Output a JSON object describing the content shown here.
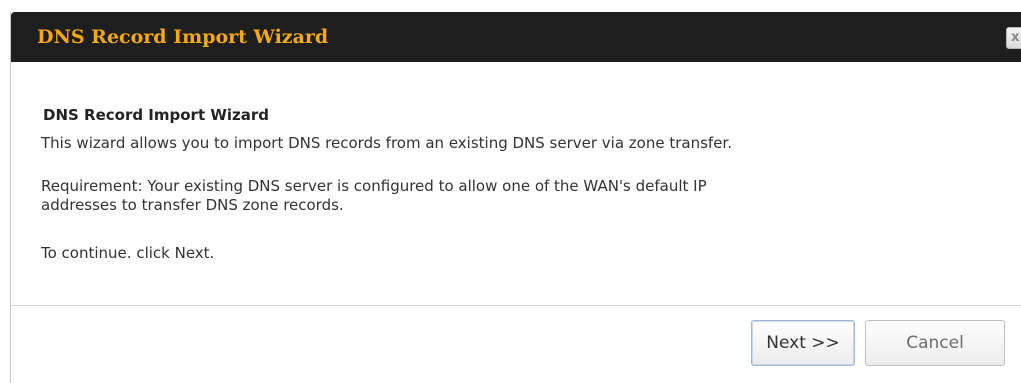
{
  "dialog": {
    "title": "DNS Record Import Wizard",
    "close_label": "x"
  },
  "content": {
    "heading": "DNS Record Import Wizard",
    "description": "This wizard allows you to import DNS records from an existing DNS server via zone transfer.",
    "requirement_line1": "Requirement: Your existing DNS server is configured to allow one of the WAN's default IP",
    "requirement_line2": "addresses to transfer DNS zone records.",
    "instruction": "To continue. click Next."
  },
  "footer": {
    "next_label": "Next >>",
    "cancel_label": "Cancel"
  },
  "colors": {
    "titlebar_bg": "#1e1e1e",
    "title_text": "#f5a913"
  }
}
